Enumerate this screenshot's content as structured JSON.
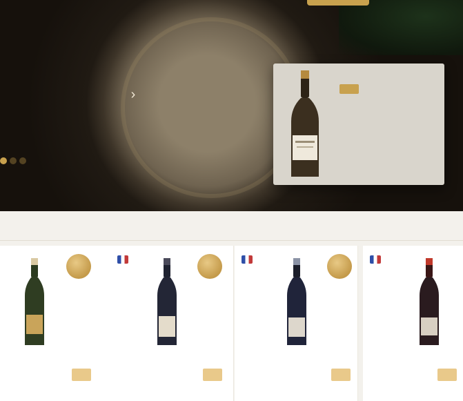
{
  "hero": {
    "eyebrow": "",
    "title": "",
    "subtitle": "",
    "next_arrow": "›",
    "slides_total": 3,
    "slide_active": 1,
    "accent_color": "#c8a14e"
  },
  "featured": {
    "kicker": "",
    "name": "",
    "price": "",
    "button_label": ""
  },
  "section": {
    "title": ""
  },
  "products": [
    {
      "name": "",
      "price": "",
      "badge": "",
      "has_flag": false,
      "cart_label": ""
    },
    {
      "name": "",
      "price": "",
      "badge": "",
      "has_flag": true,
      "cart_label": ""
    },
    {
      "name": "",
      "price": "",
      "badge": "",
      "has_flag": true,
      "cart_label": ""
    },
    {
      "name": "",
      "price": "",
      "badge": "",
      "has_flag": true,
      "cart_label": ""
    }
  ],
  "icons": {
    "hero_next": "chevron-right-icon",
    "cart": "cart-icon",
    "country_flag": "flag-icon",
    "award_badge": "medal-icon"
  }
}
